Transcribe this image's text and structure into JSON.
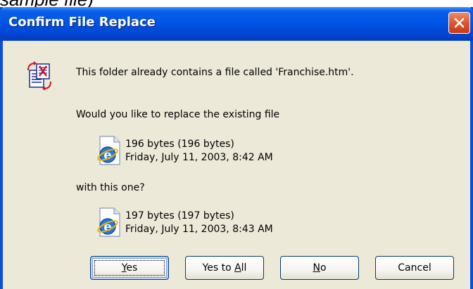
{
  "window": {
    "title": "Confirm File Replace"
  },
  "caption_fragment": "sample file)",
  "message": {
    "folder_contains": "This folder already contains a file called 'Franchise.htm'.",
    "replace_question": "Would you like to replace the existing file",
    "with_this_one": "with this one?"
  },
  "existing_file": {
    "size": "196 bytes (196 bytes)",
    "date": "Friday, July 11, 2003, 8:42 AM",
    "icon": "ie-document-icon"
  },
  "new_file": {
    "size": "197 bytes (197 bytes)",
    "date": "Friday, July 11, 2003, 8:43 AM",
    "icon": "ie-document-icon"
  },
  "buttons": {
    "yes": {
      "pre": "",
      "accel": "Y",
      "post": "es"
    },
    "yes_to_all": {
      "pre": "Yes to ",
      "accel": "A",
      "post": "ll"
    },
    "no": {
      "pre": "",
      "accel": "N",
      "post": "o"
    },
    "cancel": {
      "pre": "Cancel",
      "accel": "",
      "post": ""
    }
  },
  "colors": {
    "titlebar": "#0055e5",
    "dialog_bg": "#ece9d8",
    "close_button": "#e2542a"
  }
}
